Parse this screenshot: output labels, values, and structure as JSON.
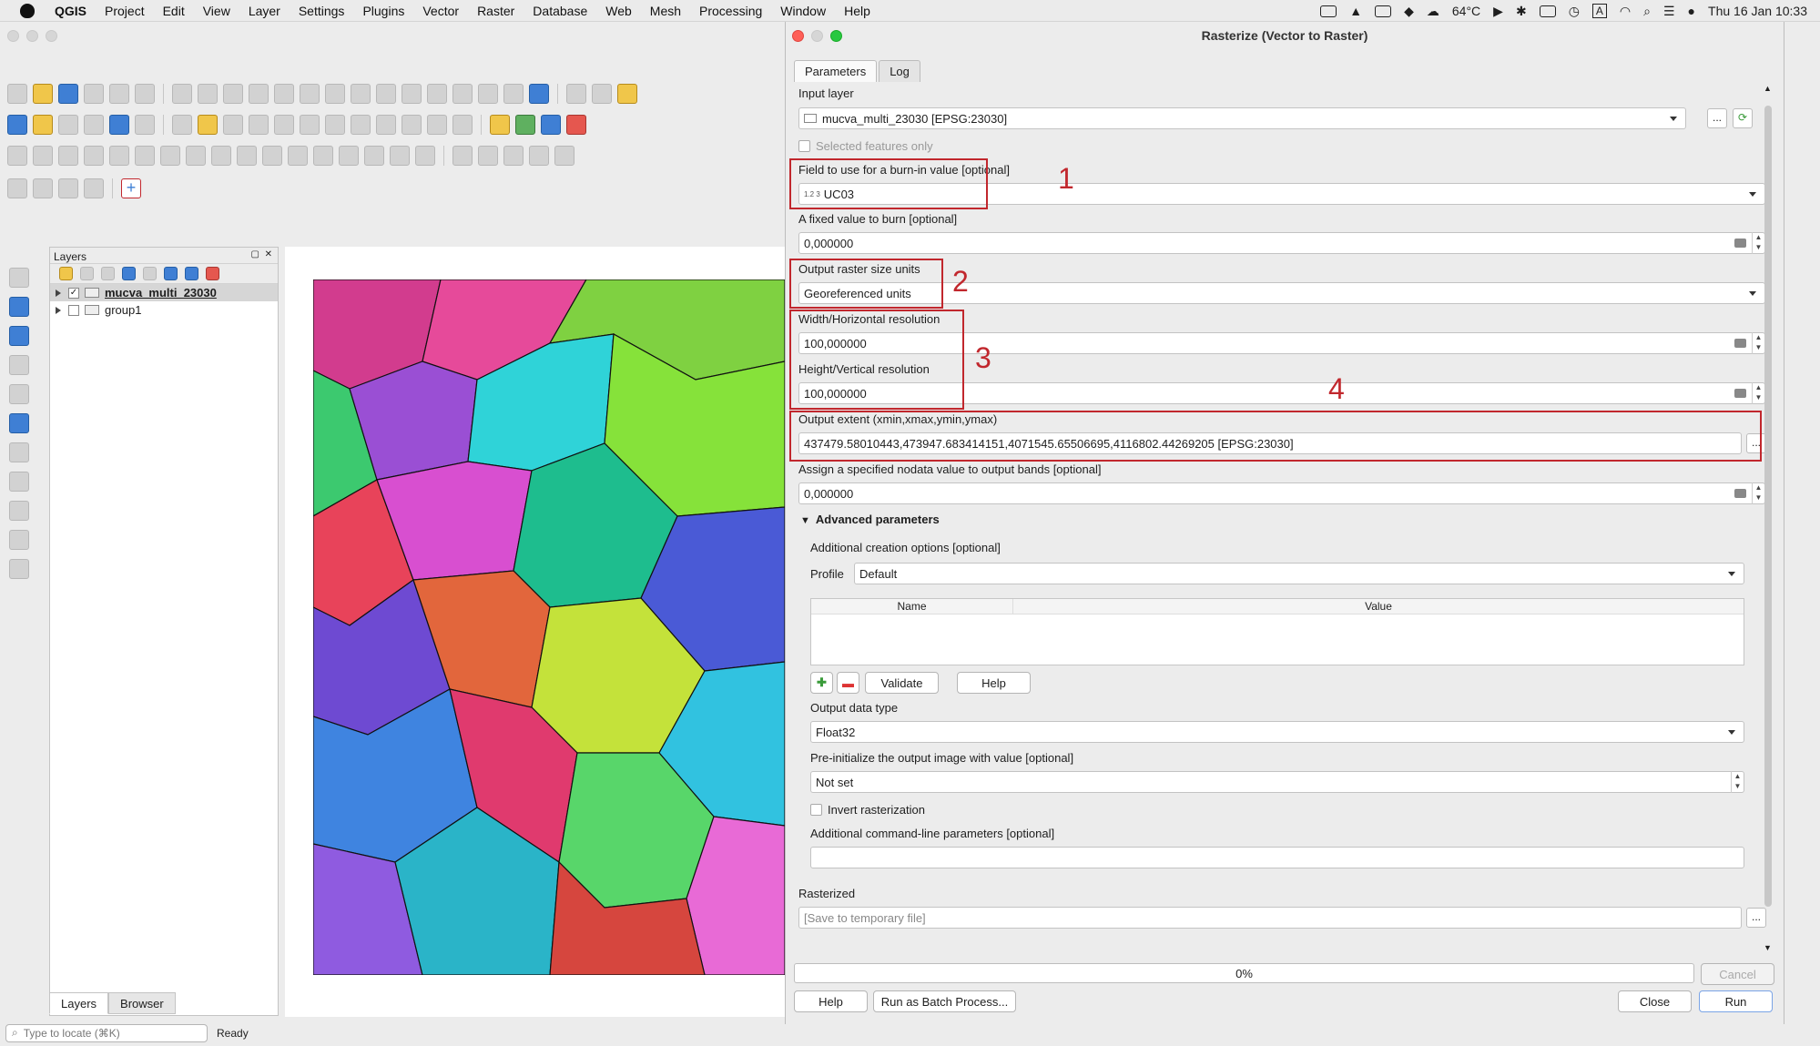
{
  "menubar": {
    "app": "QGIS",
    "items": [
      "Project",
      "Edit",
      "View",
      "Layer",
      "Settings",
      "Plugins",
      "Vector",
      "Raster",
      "Database",
      "Web",
      "Mesh",
      "Processing",
      "Window",
      "Help"
    ],
    "temperature": "64°C",
    "datetime": "Thu 16 Jan  10:33",
    "input_indicator": "A"
  },
  "layers_panel": {
    "title": "Layers",
    "layers": [
      {
        "name": "mucva_multi_23030",
        "checked": true
      },
      {
        "name": "group1",
        "checked": false
      }
    ],
    "tabs": [
      "Layers",
      "Browser"
    ]
  },
  "statusbar": {
    "locate_placeholder": "Type to locate (⌘K)",
    "message": "Ready"
  },
  "dialog": {
    "title": "Rasterize (Vector to Raster)",
    "tabs": [
      "Parameters",
      "Log"
    ],
    "input_layer_label": "Input layer",
    "input_layer_value": "mucva_multi_23030 [EPSG:23030]",
    "selected_only_label": "Selected features only",
    "burn_field_label": "Field to use for a burn-in value [optional]",
    "burn_field_value": "UC03",
    "burn_field_type": "1.2 3",
    "fixed_value_label": "A fixed value to burn [optional]",
    "fixed_value": "0,000000",
    "units_label": "Output raster size units",
    "units_value": "Georeferenced units",
    "width_label": "Width/Horizontal resolution",
    "width_value": "100,000000",
    "height_label": "Height/Vertical resolution",
    "height_value": "100,000000",
    "extent_label": "Output extent (xmin,xmax,ymin,ymax)",
    "extent_value": "437479.58010443,473947.683414151,4071545.65506695,4116802.44269205 [EPSG:23030]",
    "nodata_label": "Assign a specified nodata value to output bands [optional]",
    "nodata_value": "0,000000",
    "advanced_label": "Advanced parameters",
    "creation_options_label": "Additional creation options [optional]",
    "profile_label": "Profile",
    "profile_value": "Default",
    "table_headers": [
      "Name",
      "Value"
    ],
    "validate_label": "Validate",
    "help_small_label": "Help",
    "data_type_label": "Output data type",
    "data_type_value": "Float32",
    "preinit_label": "Pre-initialize the output image with value [optional]",
    "preinit_value": "Not set",
    "invert_label": "Invert rasterization",
    "cmdline_label": "Additional command-line parameters [optional]",
    "rasterized_label": "Rasterized",
    "rasterized_placeholder": "[Save to temporary file]",
    "progress_text": "0%",
    "cancel_label": "Cancel",
    "help_label": "Help",
    "batch_label": "Run as Batch Process...",
    "close_label": "Close",
    "run_label": "Run",
    "ellipsis": "..."
  },
  "annotations": [
    "1",
    "2",
    "3",
    "4"
  ],
  "colors": {
    "annotation_red": "#c1272d",
    "accent_blue": "#3f7fd4"
  }
}
